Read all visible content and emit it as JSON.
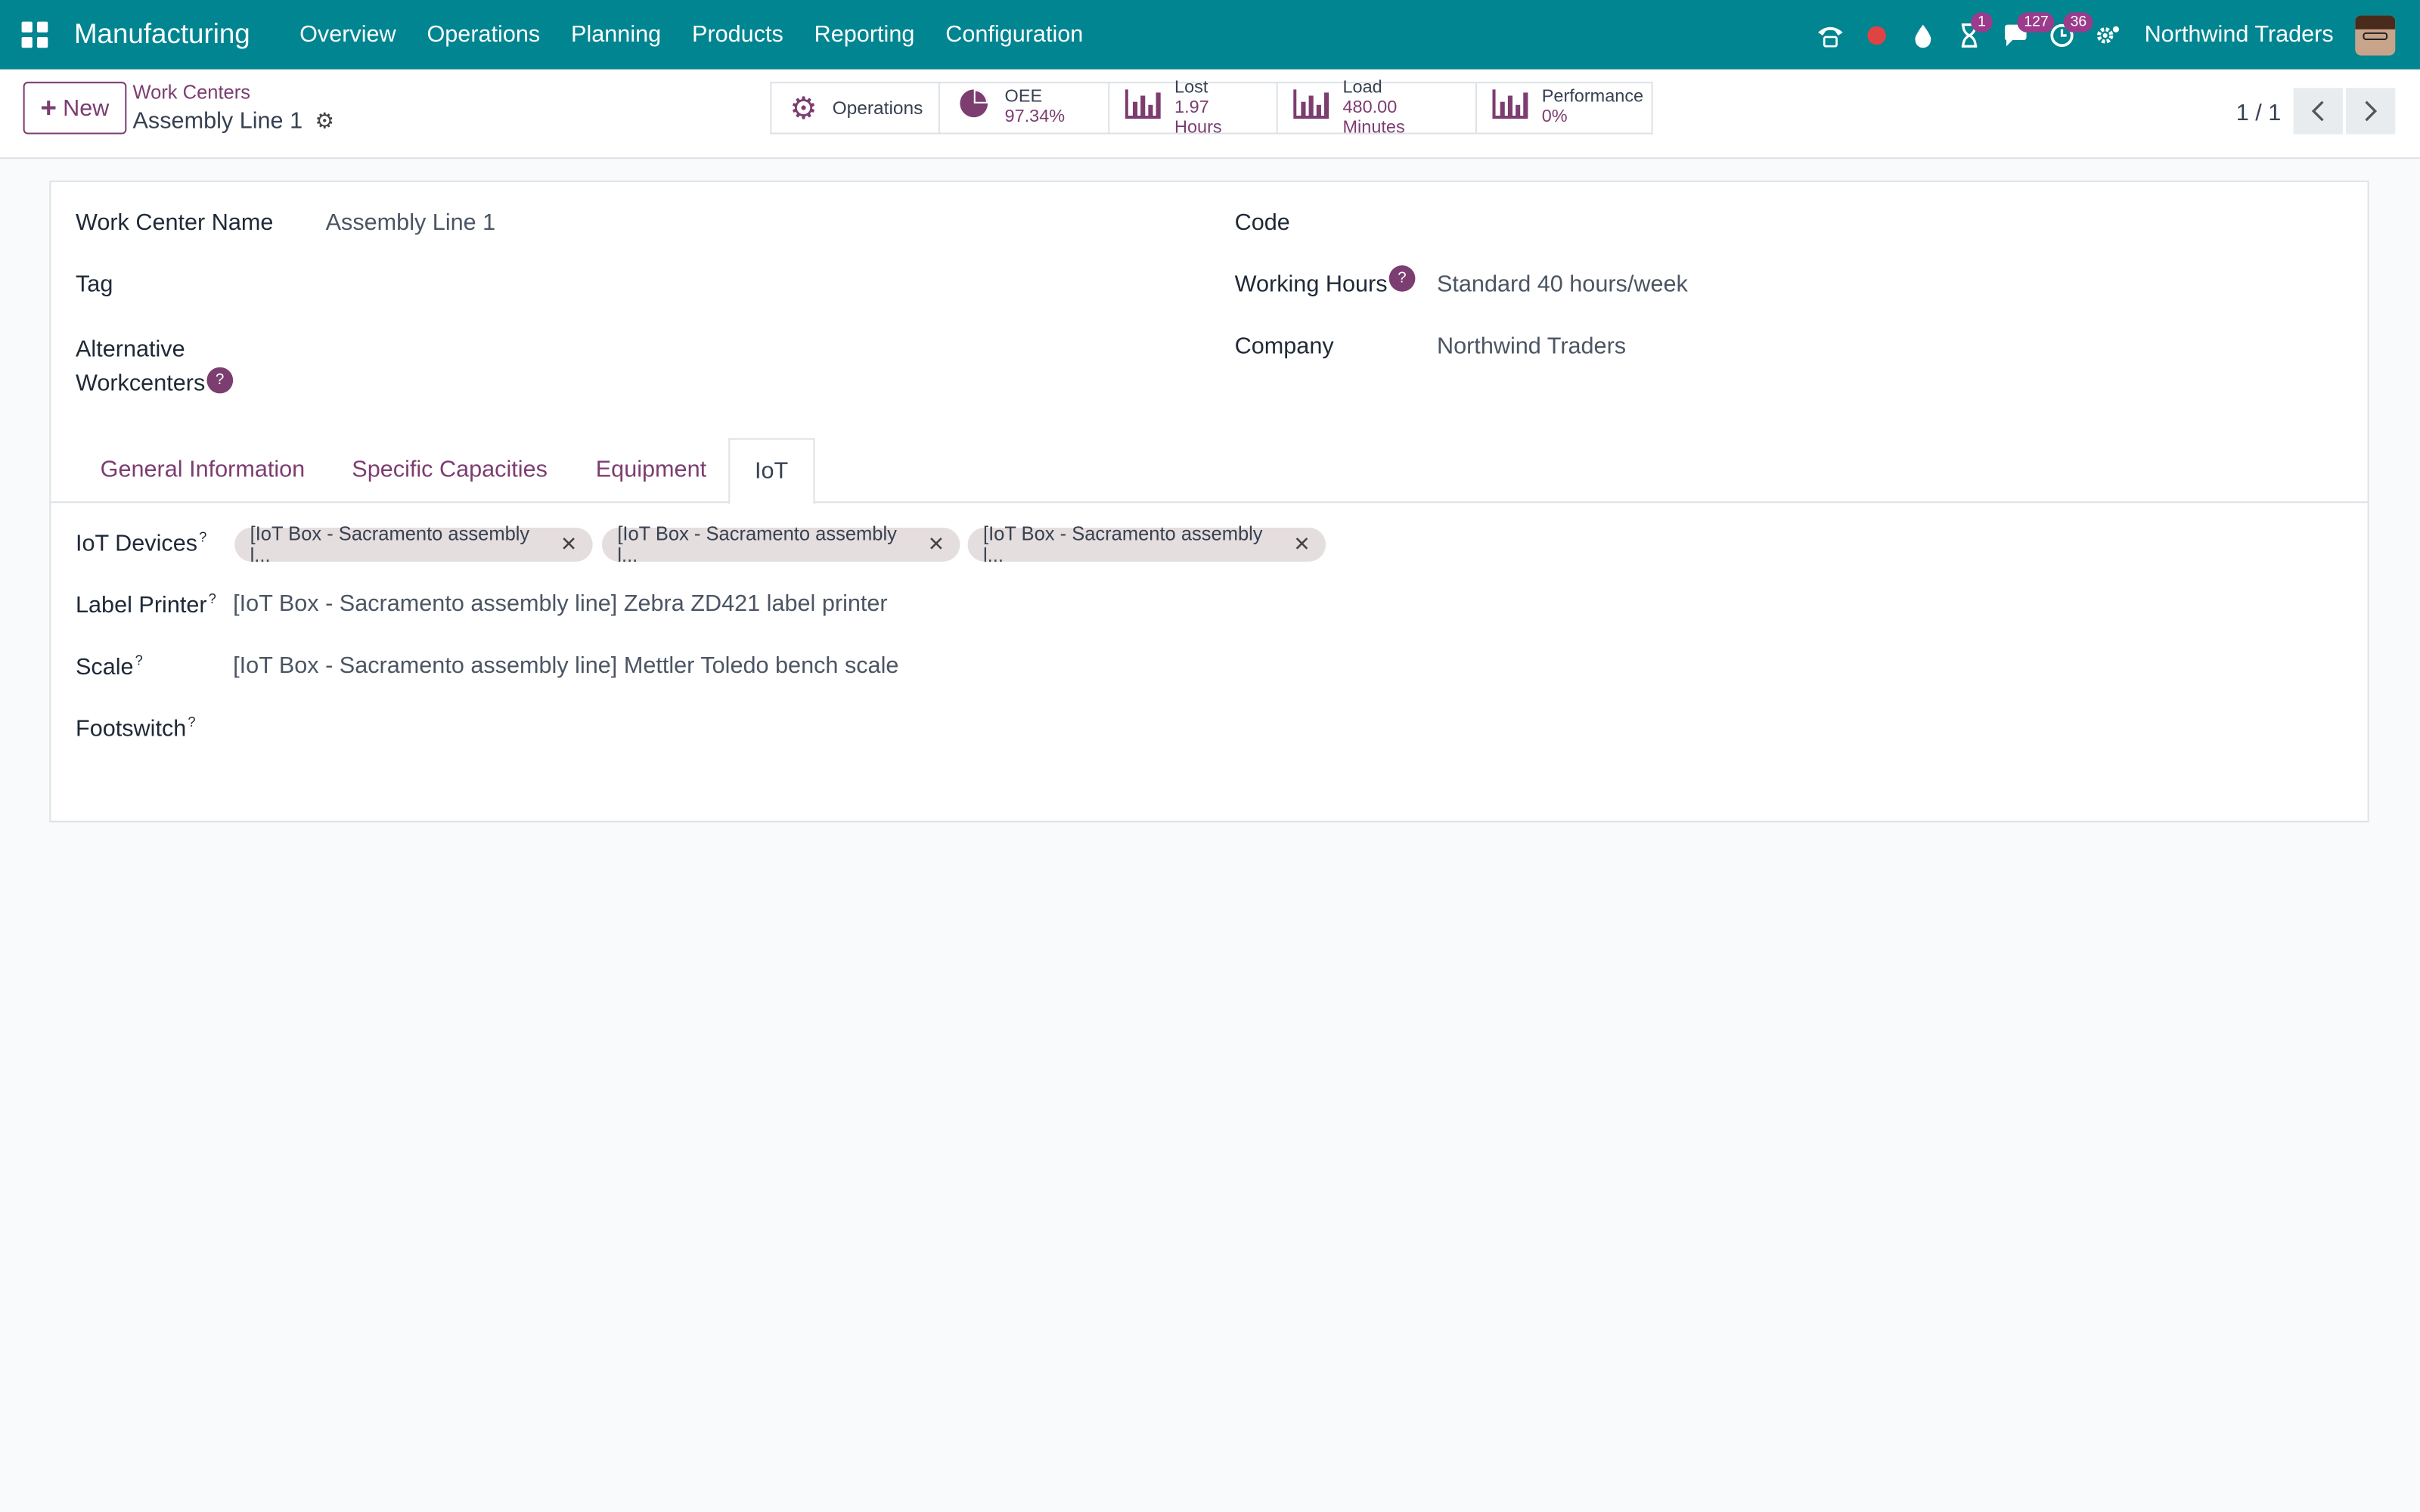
{
  "navbar": {
    "app_name": "Manufacturing",
    "menu": [
      "Overview",
      "Operations",
      "Planning",
      "Products",
      "Reporting",
      "Configuration"
    ],
    "badges": {
      "activities": "1",
      "messages": "127",
      "clock": "36"
    },
    "company": "Northwind Traders"
  },
  "control": {
    "new_label": "New",
    "breadcrumb": "Work Centers",
    "record_title": "Assembly Line 1",
    "stats": {
      "operations": "Operations",
      "oee_label": "OEE",
      "oee_value": "97.34%",
      "lost_label": "Lost",
      "lost_value": "1.97 Hours",
      "load_label": "Load",
      "load_value": "480.00 Minutes",
      "performance_label": "Performance",
      "performance_value": "0%"
    },
    "pager": "1 / 1"
  },
  "form": {
    "work_center_name_label": "Work Center Name",
    "work_center_name_value": "Assembly Line 1",
    "tag_label": "Tag",
    "alternative_label_1": "Alternative",
    "alternative_label_2": "Workcenters",
    "code_label": "Code",
    "working_hours_label": "Working Hours",
    "working_hours_value": "Standard 40 hours/week",
    "company_label": "Company",
    "company_value": "Northwind Traders",
    "help_mark": "?"
  },
  "tabs": [
    "General Information",
    "Specific Capacities",
    "Equipment",
    "IoT"
  ],
  "iot": {
    "devices_label": "IoT Devices",
    "devices": [
      "[IoT Box - Sacramento assembly l...",
      "[IoT Box - Sacramento assembly l...",
      "[IoT Box - Sacramento assembly l..."
    ],
    "label_printer_label": "Label Printer",
    "label_printer_value": "[IoT Box - Sacramento assembly line] Zebra ZD421 label printer",
    "scale_label": "Scale",
    "scale_value": "[IoT Box - Sacramento assembly line] Mettler Toledo bench scale",
    "footswitch_label": "Footswitch"
  },
  "colors": {
    "navbar": "#008591",
    "accent": "#7c3d70",
    "badge": "#9b3b8c"
  }
}
